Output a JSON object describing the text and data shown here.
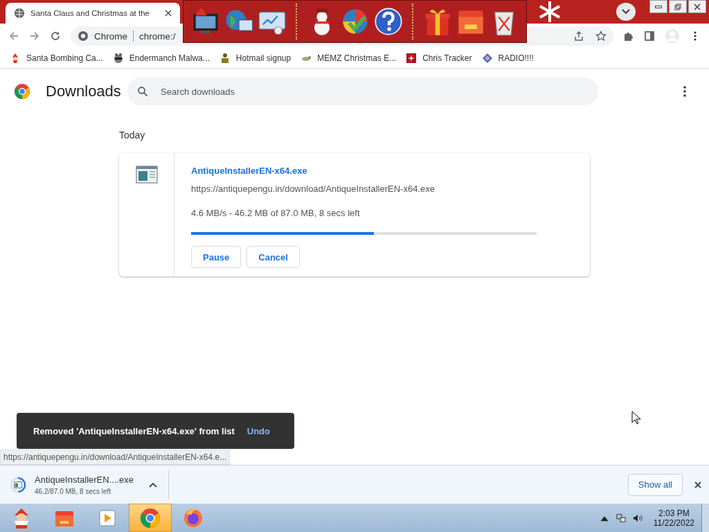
{
  "tab": {
    "title": "Santa Claus and Christmas at the"
  },
  "omnibox": {
    "site": "Chrome",
    "url": "chrome:/"
  },
  "bookmarks": [
    {
      "label": "Santa Bombing Ca...",
      "kind": "santa"
    },
    {
      "label": "Endermanch Malwa...",
      "kind": "raccoon"
    },
    {
      "label": "Hotmail signup",
      "kind": "person"
    },
    {
      "label": "MEMZ Christmas E...",
      "kind": "lizard"
    },
    {
      "label": "Chris Tracker",
      "kind": "star"
    },
    {
      "label": "RADIO!!!!",
      "kind": "diamond"
    }
  ],
  "page": {
    "title": "Downloads",
    "search": {
      "placeholder": "Search downloads"
    }
  },
  "section": "Today",
  "download": {
    "filename": "AntiqueInstallerEN-x64.exe",
    "url": "https://antiquepengu.in/download/AntiqueInstallerEN-x64.exe",
    "status": "4.6 MB/s - 46.2 MB of 87.0 MB, 8 secs left",
    "level": 0.53,
    "buttons": [
      "Pause",
      "Cancel"
    ]
  },
  "snackbar": {
    "message": "Removed 'AntiqueInstallerEN-x64.exe' from list",
    "action": "Undo"
  },
  "status_url": "https://antiquepengu.in/download/AntiqueInstallerEN-x64.e...",
  "shelf": {
    "filename": "AntiqueInstallerEN....exe",
    "status": "46.2/87.0 MB, 8 secs left",
    "show_all": "Show all"
  },
  "taskbar": {
    "apps": [
      {
        "kind": "santa",
        "selected": false
      },
      {
        "kind": "folder",
        "selected": false
      },
      {
        "kind": "media",
        "selected": false
      },
      {
        "kind": "chrome",
        "selected": true
      },
      {
        "kind": "firefox",
        "selected": false
      }
    ],
    "time": "2:03 PM",
    "date": "11/22/2022"
  }
}
